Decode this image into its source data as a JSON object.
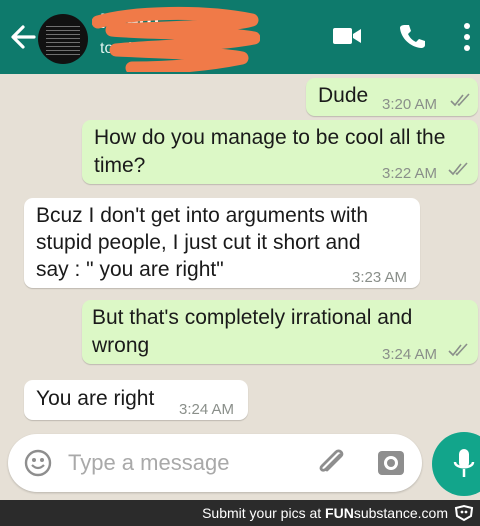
{
  "header": {
    "contact_name": "H          lerg",
    "contact_status": "toc          AM"
  },
  "messages": [
    {
      "direction": "outgoing",
      "text_lines": [
        "Dude"
      ],
      "time": "3:20 AM",
      "read": true
    },
    {
      "direction": "outgoing",
      "text_lines": [
        "How do you manage to be cool all the",
        "time?"
      ],
      "time": "3:22 AM",
      "read": true
    },
    {
      "direction": "incoming",
      "text_lines": [
        "Bcuz I don't get into arguments with",
        "stupid people, I just cut it short and",
        "say : \" you are right\""
      ],
      "time": "3:23 AM"
    },
    {
      "direction": "outgoing",
      "text_lines": [
        "But that's completely irrational and",
        "wrong"
      ],
      "time": "3:24 AM",
      "read": true
    },
    {
      "direction": "incoming",
      "text_lines": [
        "You are right"
      ],
      "time": "3:24 AM"
    }
  ],
  "composer": {
    "placeholder": "Type a message"
  },
  "footer": {
    "text": "Submit your pics at",
    "brand_prefix": "FUN",
    "brand_suffix": "substance.com"
  },
  "colors": {
    "header": "#0e7a6c",
    "outgoing_bubble": "#dcf8c6",
    "incoming_bubble": "#ffffff",
    "mic_button": "#12a58b",
    "redaction": "#f07a48"
  },
  "icons": [
    "back-arrow-icon",
    "video-call-icon",
    "phone-icon",
    "more-options-icon",
    "emoji-icon",
    "attach-icon",
    "camera-icon",
    "mic-icon"
  ]
}
